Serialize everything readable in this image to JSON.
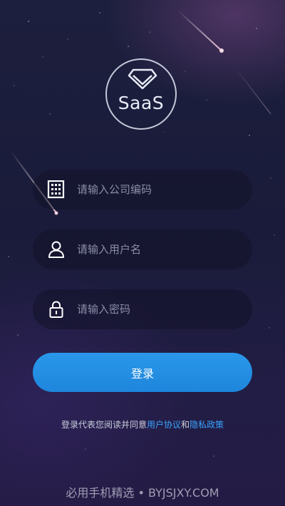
{
  "logo": {
    "text": "SaaS",
    "icon": "diamond-icon"
  },
  "form": {
    "company": {
      "placeholder": "请输入公司编码",
      "icon": "building-icon"
    },
    "username": {
      "placeholder": "请输入用户名",
      "icon": "user-icon"
    },
    "password": {
      "placeholder": "请输入密码",
      "icon": "lock-icon"
    }
  },
  "login_label": "登录",
  "agreement": {
    "prefix": "登录代表您阅读并同意",
    "user_agreement": "用户协议",
    "and": "和",
    "privacy_policy": "隐私政策"
  },
  "watermark": "必用手机精选 • BYJSJXY.COM",
  "colors": {
    "accent": "#2196e8",
    "link": "#3aa3ff",
    "background": "#1c1d3e"
  }
}
